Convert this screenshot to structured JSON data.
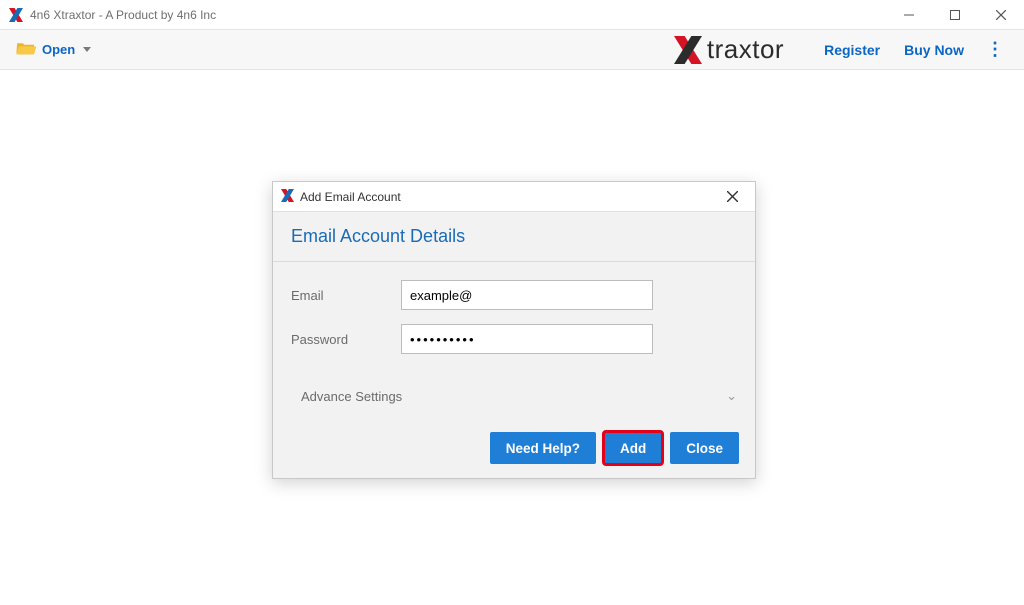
{
  "window": {
    "title": "4n6 Xtraxtor - A Product by 4n6 Inc"
  },
  "toolbar": {
    "open_label": "Open",
    "register_label": "Register",
    "buynow_label": "Buy Now",
    "brand_text": "traxtor"
  },
  "dialog": {
    "title": "Add Email Account",
    "header": "Email Account Details",
    "email_label": "Email",
    "email_value": "example@",
    "password_label": "Password",
    "password_value": "••••••••••",
    "advance_label": "Advance Settings",
    "buttons": {
      "help": "Need Help?",
      "add": "Add",
      "close": "Close"
    }
  }
}
